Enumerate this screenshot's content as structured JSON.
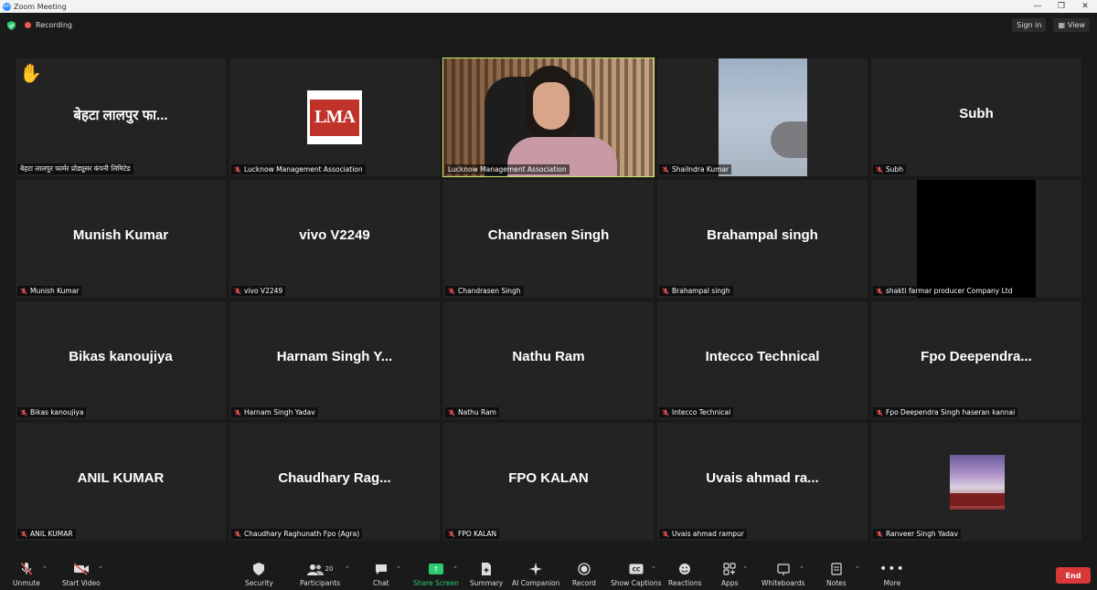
{
  "window": {
    "title": "Zoom Meeting"
  },
  "topbar": {
    "recording": "Recording",
    "sign_in": "Sign in",
    "view": "View"
  },
  "tiles": [
    {
      "big": "बेहटा लालपुर फा...",
      "label": "बेहटा लालपुर फार्मर प्रोड्यूसर कंपनी लिमिटेड",
      "muted": false,
      "hand": "✋"
    },
    {
      "big": "",
      "label": "Lucknow Management Association",
      "muted": true,
      "logo": "LMA"
    },
    {
      "big": "",
      "label": "Lucknow Management Association",
      "muted": false,
      "video": true
    },
    {
      "big": "",
      "label": "Shailndra Kumar",
      "muted": true
    },
    {
      "big": "Subh",
      "label": "Subh",
      "muted": true
    },
    {
      "big": "Munish Kumar",
      "label": "Munish Kumar",
      "muted": true
    },
    {
      "big": "vivo V2249",
      "label": "vivo V2249",
      "muted": true
    },
    {
      "big": "Chandrasen Singh",
      "label": "Chandrasen Singh",
      "muted": true
    },
    {
      "big": "Brahampal singh",
      "label": "Brahampal singh",
      "muted": true
    },
    {
      "big": "",
      "label": "shakti farmar producer Company Ltd",
      "muted": true
    },
    {
      "big": "Bikas kanoujiya",
      "label": "Bikas kanoujiya",
      "muted": true
    },
    {
      "big": "Harnam Singh Y...",
      "label": "Harnam Singh Yadav",
      "muted": true
    },
    {
      "big": "Nathu Ram",
      "label": "Nathu Ram",
      "muted": true
    },
    {
      "big": "Intecco Technical",
      "label": "Intecco Technical",
      "muted": true
    },
    {
      "big": "Fpo  Deependra...",
      "label": "Fpo Deependra Singh haseran kannai",
      "muted": true
    },
    {
      "big": "ANIL KUMAR",
      "label": "ANIL KUMAR",
      "muted": true
    },
    {
      "big": "Chaudhary  Rag...",
      "label": "Chaudhary Raghunath Fpo (Agra)",
      "muted": true
    },
    {
      "big": "FPO KALAN",
      "label": "FPO KALAN",
      "muted": true
    },
    {
      "big": "Uvais ahmad ra...",
      "label": "Uvais ahmad rampur",
      "muted": true
    },
    {
      "big": "",
      "label": "Ranveer Singh Yadav",
      "muted": true
    }
  ],
  "toolbar": {
    "unmute": "Unmute",
    "start_video": "Start Video",
    "security": "Security",
    "participants": "Participants",
    "participants_count": "20",
    "chat": "Chat",
    "share_screen": "Share Screen",
    "summary": "Summary",
    "ai_companion": "AI Companion",
    "record": "Record",
    "show_captions": "Show Captions",
    "reactions": "Reactions",
    "apps": "Apps",
    "whiteboards": "Whiteboards",
    "notes": "Notes",
    "more": "More",
    "end": "End"
  },
  "colors": {
    "active_border": "#cde86a",
    "share_green": "#2dcc70",
    "end_red": "#d93838",
    "mute_red": "#e55"
  }
}
